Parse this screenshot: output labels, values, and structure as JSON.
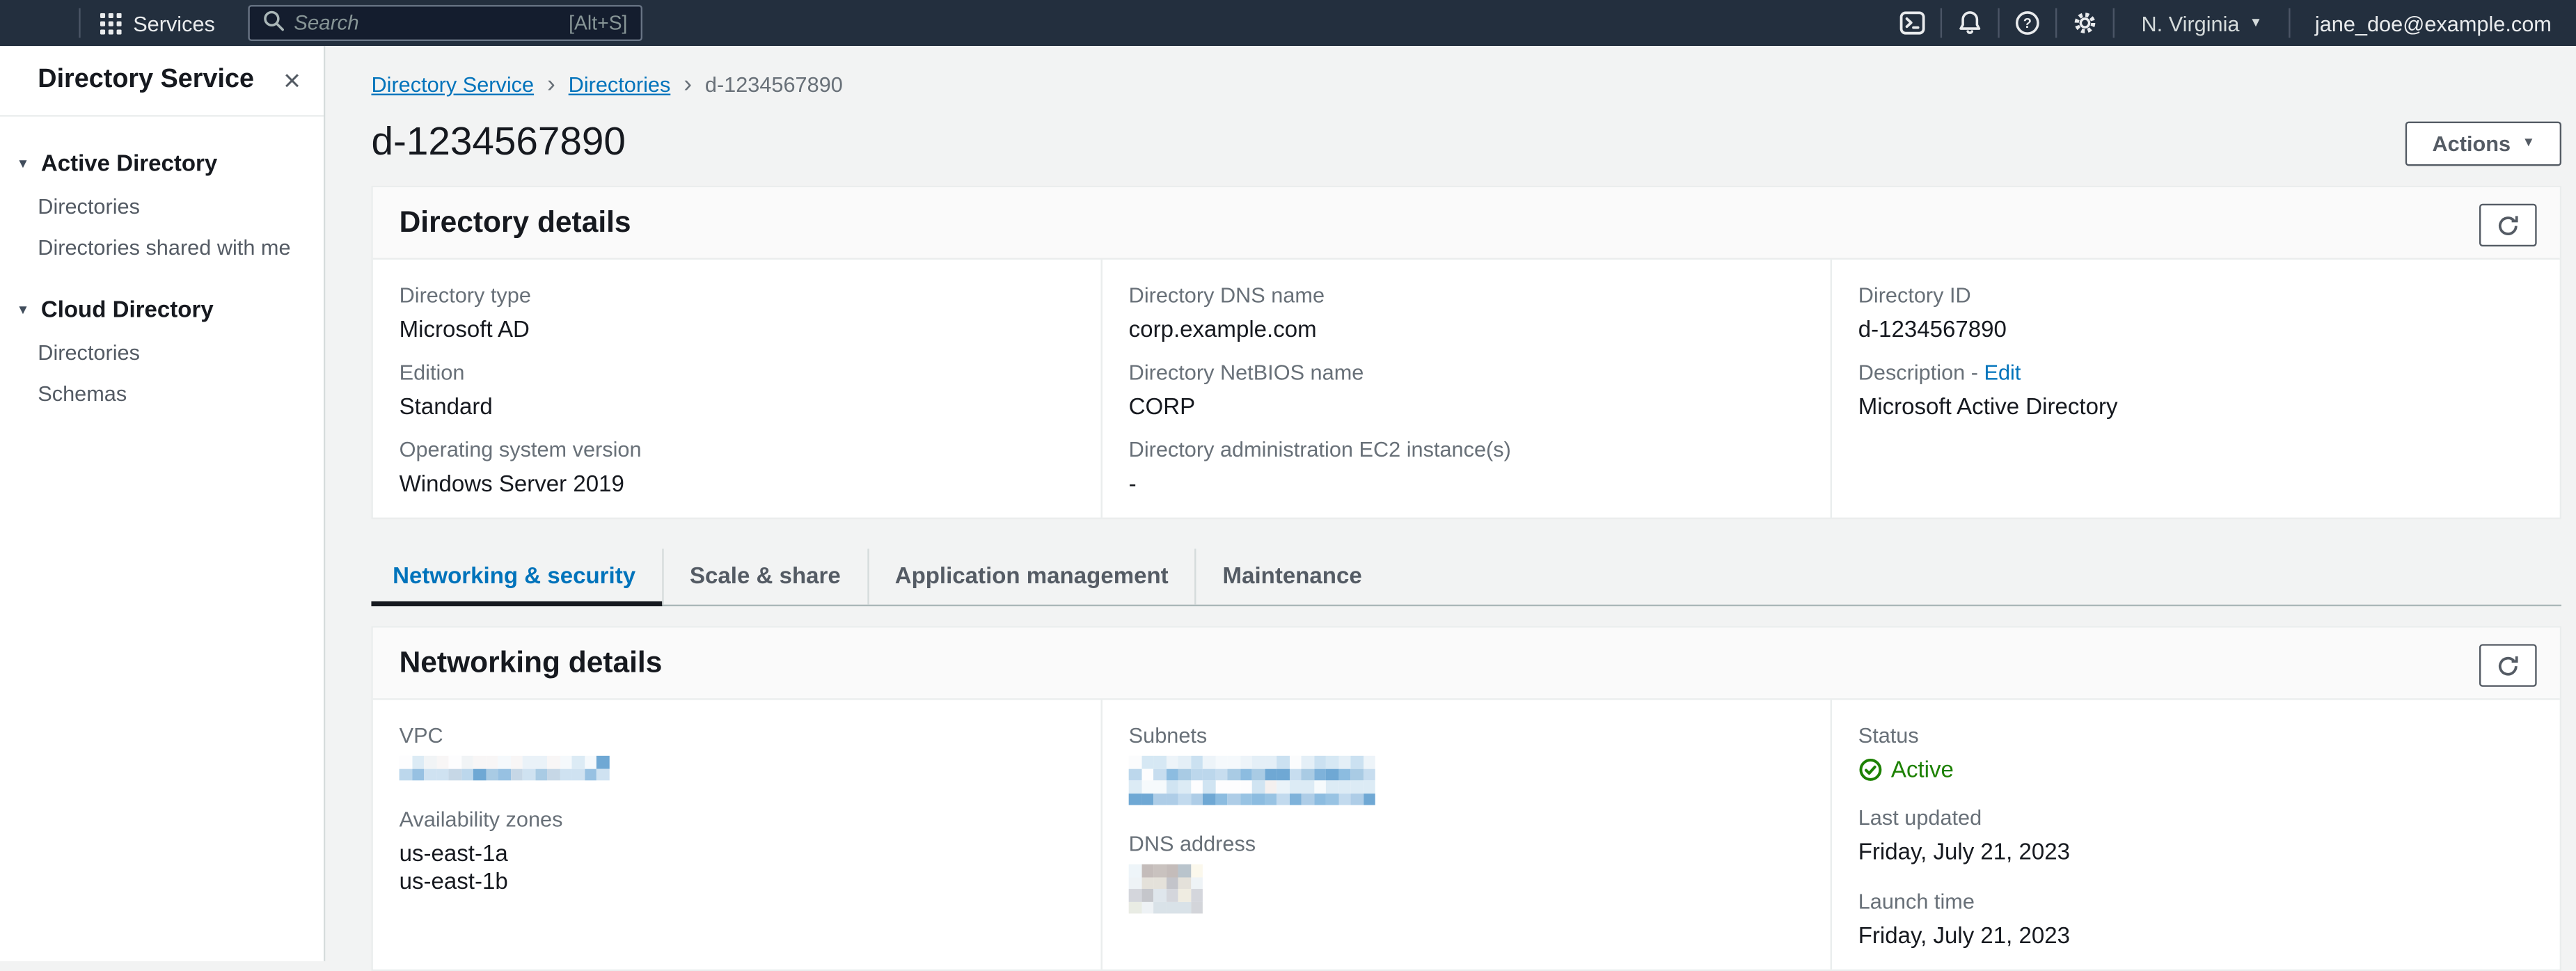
{
  "topnav": {
    "services_label": "Services",
    "search": {
      "placeholder": "Search",
      "shortcut": "[Alt+S]"
    },
    "region": "N. Virginia",
    "account": "jane_doe@example.com"
  },
  "icons": {
    "caret_down": "▼",
    "close": "×",
    "breadcrumb_separator": "›",
    "section_caret": "▼"
  },
  "sidebar": {
    "title": "Directory Service",
    "sections": [
      {
        "label": "Active Directory",
        "items": [
          "Directories",
          "Directories shared with me"
        ]
      },
      {
        "label": "Cloud Directory",
        "items": [
          "Directories",
          "Schemas"
        ]
      }
    ]
  },
  "breadcrumb": {
    "items": [
      "Directory Service",
      "Directories",
      "d-1234567890"
    ]
  },
  "page": {
    "title": "d-1234567890",
    "actions_label": "Actions"
  },
  "directory_details": {
    "title": "Directory details",
    "columns": [
      {
        "fields": [
          {
            "label": "Directory type",
            "value": "Microsoft AD"
          },
          {
            "label": "Edition",
            "value": "Standard"
          },
          {
            "label": "Operating system version",
            "value": "Windows Server 2019"
          }
        ]
      },
      {
        "fields": [
          {
            "label": "Directory DNS name",
            "value": "corp.example.com"
          },
          {
            "label": "Directory NetBIOS name",
            "value": "CORP"
          },
          {
            "label": "Directory administration EC2 instance(s)",
            "value": "-"
          }
        ]
      },
      {
        "fields": [
          {
            "label": "Directory ID",
            "value": "d-1234567890"
          },
          {
            "label": "Description -",
            "link": "Edit",
            "value": "Microsoft Active Directory"
          }
        ]
      }
    ]
  },
  "tabs": [
    {
      "label": "Networking & security",
      "active": true
    },
    {
      "label": "Scale & share",
      "active": false
    },
    {
      "label": "Application management",
      "active": false
    },
    {
      "label": "Maintenance",
      "active": false
    }
  ],
  "networking_details": {
    "title": "Networking details",
    "vpc_label": "VPC",
    "az_label": "Availability zones",
    "az_values": [
      "us-east-1a",
      "us-east-1b"
    ],
    "subnets_label": "Subnets",
    "dns_label": "DNS address",
    "status_label": "Status",
    "status_value": "Active",
    "last_updated_label": "Last updated",
    "last_updated_value": "Friday, July 21, 2023",
    "launch_time_label": "Launch time",
    "launch_time_value": "Friday, July 21, 2023"
  },
  "colors": {
    "nav_bg": "#232f3e",
    "link_blue": "#0073bb",
    "status_green": "#1d8102",
    "label_gray": "#687078",
    "text_dark": "#16191f"
  }
}
